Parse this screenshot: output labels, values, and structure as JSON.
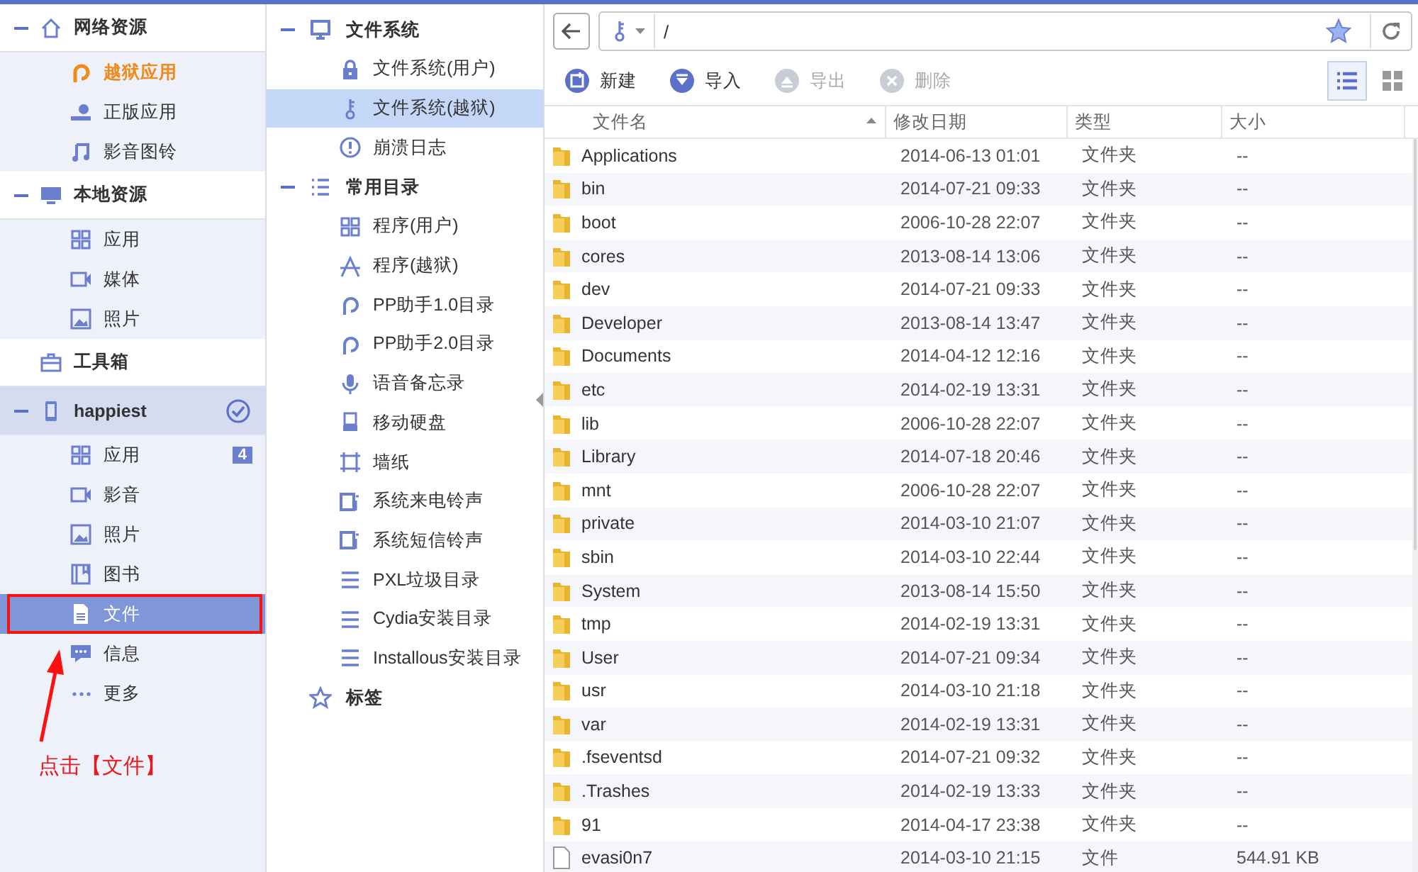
{
  "left_sidebar": {
    "sections": [
      {
        "title": "网络资源",
        "expanded": true,
        "checked": false,
        "items": [
          {
            "label": "越狱应用",
            "highlighted": true,
            "selected": false
          },
          {
            "label": "正版应用",
            "highlighted": false,
            "selected": false
          },
          {
            "label": "影音图铃",
            "highlighted": false,
            "selected": false
          }
        ]
      },
      {
        "title": "本地资源",
        "expanded": true,
        "checked": false,
        "items": [
          {
            "label": "应用",
            "highlighted": false,
            "selected": false
          },
          {
            "label": "媒体",
            "highlighted": false,
            "selected": false
          },
          {
            "label": "照片",
            "highlighted": false,
            "selected": false
          }
        ]
      },
      {
        "title": "工具箱",
        "expanded": false,
        "checked": false
      },
      {
        "title": "happiest",
        "expanded": true,
        "checked": true,
        "items": [
          {
            "label": "应用",
            "badge": "4",
            "highlighted": false,
            "selected": false
          },
          {
            "label": "影音",
            "highlighted": false,
            "selected": false
          },
          {
            "label": "照片",
            "highlighted": false,
            "selected": false
          },
          {
            "label": "图书",
            "highlighted": false,
            "selected": false
          },
          {
            "label": "文件",
            "highlighted": false,
            "selected": true
          },
          {
            "label": "信息",
            "highlighted": false,
            "selected": false
          },
          {
            "label": "更多",
            "highlighted": false,
            "selected": false
          }
        ]
      }
    ]
  },
  "annotation": {
    "text": "点击【文件】"
  },
  "folder_tree": {
    "sections": [
      {
        "title": "文件系统",
        "expanded": true,
        "items": [
          {
            "label": "文件系统(用户)",
            "selected": false
          },
          {
            "label": "文件系统(越狱)",
            "selected": true
          },
          {
            "label": "崩溃日志",
            "selected": false
          }
        ]
      },
      {
        "title": "常用目录",
        "expanded": true,
        "items": [
          {
            "label": "程序(用户)",
            "selected": false
          },
          {
            "label": "程序(越狱)",
            "selected": false
          },
          {
            "label": "PP助手1.0目录",
            "selected": false
          },
          {
            "label": "PP助手2.0目录",
            "selected": false
          },
          {
            "label": "语音备忘录",
            "selected": false
          },
          {
            "label": "移动硬盘",
            "selected": false
          },
          {
            "label": "墙纸",
            "selected": false
          },
          {
            "label": "系统来电铃声",
            "selected": false
          },
          {
            "label": "系统短信铃声",
            "selected": false
          },
          {
            "label": "PXL垃圾目录",
            "selected": false
          },
          {
            "label": "Cydia安装目录",
            "selected": false
          },
          {
            "label": "Installous安装目录",
            "selected": false
          }
        ]
      },
      {
        "title": "标签",
        "expanded": false
      }
    ]
  },
  "address_bar": {
    "path": "/"
  },
  "toolbar": {
    "buttons": [
      {
        "label": "新建",
        "disabled": false
      },
      {
        "label": "导入",
        "disabled": false
      },
      {
        "label": "导出",
        "disabled": true
      },
      {
        "label": "删除",
        "disabled": true
      }
    ],
    "views": [
      {
        "selected": true
      },
      {
        "selected": false
      }
    ]
  },
  "table": {
    "columns": [
      {
        "label": "文件名",
        "sorted": true
      },
      {
        "label": "修改日期",
        "sorted": false
      },
      {
        "label": "类型",
        "sorted": false
      },
      {
        "label": "大小",
        "sorted": false
      }
    ],
    "rows": [
      {
        "name": "Applications",
        "date": "2014-06-13 01:01",
        "type": "文件夹",
        "size": "--",
        "kind": "folder"
      },
      {
        "name": "bin",
        "date": "2014-07-21 09:33",
        "type": "文件夹",
        "size": "--",
        "kind": "folder"
      },
      {
        "name": "boot",
        "date": "2006-10-28 22:07",
        "type": "文件夹",
        "size": "--",
        "kind": "folder"
      },
      {
        "name": "cores",
        "date": "2013-08-14 13:06",
        "type": "文件夹",
        "size": "--",
        "kind": "folder"
      },
      {
        "name": "dev",
        "date": "2014-07-21 09:33",
        "type": "文件夹",
        "size": "--",
        "kind": "folder"
      },
      {
        "name": "Developer",
        "date": "2013-08-14 13:47",
        "type": "文件夹",
        "size": "--",
        "kind": "folder"
      },
      {
        "name": "Documents",
        "date": "2014-04-12 12:16",
        "type": "文件夹",
        "size": "--",
        "kind": "folder"
      },
      {
        "name": "etc",
        "date": "2014-02-19 13:31",
        "type": "文件夹",
        "size": "--",
        "kind": "folder"
      },
      {
        "name": "lib",
        "date": "2006-10-28 22:07",
        "type": "文件夹",
        "size": "--",
        "kind": "folder"
      },
      {
        "name": "Library",
        "date": "2014-07-18 20:46",
        "type": "文件夹",
        "size": "--",
        "kind": "folder"
      },
      {
        "name": "mnt",
        "date": "2006-10-28 22:07",
        "type": "文件夹",
        "size": "--",
        "kind": "folder"
      },
      {
        "name": "private",
        "date": "2014-03-10 21:07",
        "type": "文件夹",
        "size": "--",
        "kind": "folder"
      },
      {
        "name": "sbin",
        "date": "2014-03-10 22:44",
        "type": "文件夹",
        "size": "--",
        "kind": "folder"
      },
      {
        "name": "System",
        "date": "2013-08-14 15:50",
        "type": "文件夹",
        "size": "--",
        "kind": "folder"
      },
      {
        "name": "tmp",
        "date": "2014-02-19 13:31",
        "type": "文件夹",
        "size": "--",
        "kind": "folder"
      },
      {
        "name": "User",
        "date": "2014-07-21 09:34",
        "type": "文件夹",
        "size": "--",
        "kind": "folder"
      },
      {
        "name": "usr",
        "date": "2014-03-10 21:18",
        "type": "文件夹",
        "size": "--",
        "kind": "folder"
      },
      {
        "name": "var",
        "date": "2014-02-19 13:31",
        "type": "文件夹",
        "size": "--",
        "kind": "folder"
      },
      {
        "name": ".fseventsd",
        "date": "2014-07-21 09:32",
        "type": "文件夹",
        "size": "--",
        "kind": "folder"
      },
      {
        "name": ".Trashes",
        "date": "2014-02-19 13:33",
        "type": "文件夹",
        "size": "--",
        "kind": "folder"
      },
      {
        "name": "91",
        "date": "2014-04-17 23:38",
        "type": "文件夹",
        "size": "--",
        "kind": "folder"
      },
      {
        "name": "evasi0n7",
        "date": "2014-03-10 21:15",
        "type": "文件",
        "size": "544.91 KB",
        "kind": "file"
      }
    ]
  }
}
